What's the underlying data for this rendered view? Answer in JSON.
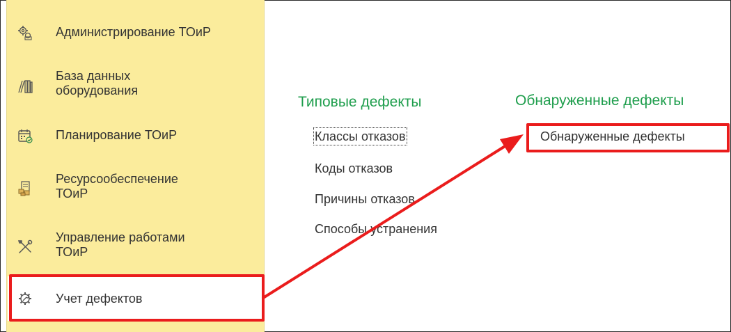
{
  "sidebar": {
    "items": [
      {
        "label": "Администрирование ТОиР",
        "icon": "settings-gears-icon"
      },
      {
        "label": "База данных\nоборудования",
        "icon": "books-icon"
      },
      {
        "label": "Планирование ТОиР",
        "icon": "calendar-check-icon"
      },
      {
        "label": "Ресурсообеспечение\nТОиР",
        "icon": "boxes-clipboard-icon"
      },
      {
        "label": "Управление работами\nТОиР",
        "icon": "tools-icon"
      },
      {
        "label": "Учет дефектов",
        "icon": "gear-wrench-icon",
        "selected": true
      }
    ]
  },
  "content": {
    "typical_defects": {
      "title": "Типовые дефекты",
      "links": [
        "Классы отказов",
        "Коды отказов",
        "Причины отказов",
        "Способы устранения"
      ]
    },
    "detected_defects": {
      "title": "Обнаруженные дефекты",
      "links": [
        "Обнаруженные дефекты"
      ]
    }
  },
  "colors": {
    "sidebar_bg": "#fbec9c",
    "group_title": "#1f9e4d",
    "annotation": "#ea1c1c"
  }
}
